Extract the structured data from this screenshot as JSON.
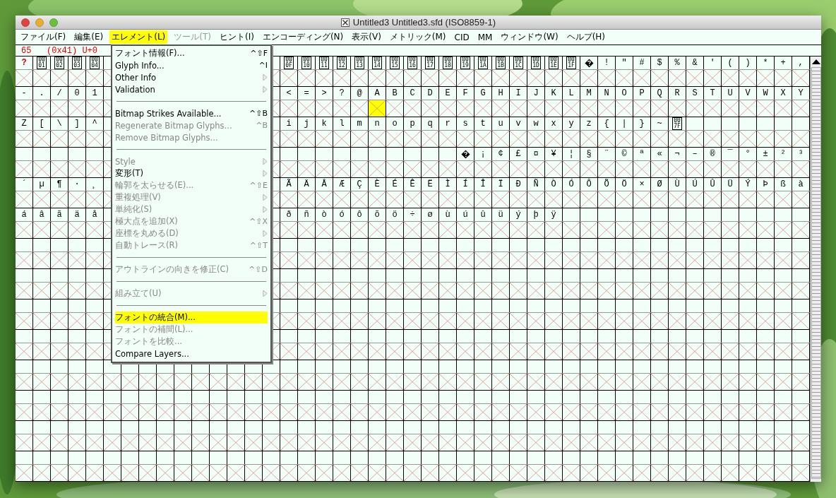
{
  "window": {
    "title": "Untitled3  Untitled3.sfd (ISO8859-1)"
  },
  "menubar": [
    {
      "label": "ファイル(F)",
      "selected": false,
      "disabled": false
    },
    {
      "label": "編集(E)",
      "selected": false,
      "disabled": false
    },
    {
      "label": "エレメント(L)",
      "selected": true,
      "disabled": false
    },
    {
      "label": "ツール(T)",
      "selected": false,
      "disabled": true
    },
    {
      "label": "ヒント(I)",
      "selected": false,
      "disabled": false
    },
    {
      "label": "エンコーディング(N)",
      "selected": false,
      "disabled": false
    },
    {
      "label": "表示(V)",
      "selected": false,
      "disabled": false
    },
    {
      "label": "メトリック(M)",
      "selected": false,
      "disabled": false
    },
    {
      "label": "CID",
      "selected": false,
      "disabled": false
    },
    {
      "label": "MM",
      "selected": false,
      "disabled": false
    },
    {
      "label": "ウィンドウ(W)",
      "selected": false,
      "disabled": false
    },
    {
      "label": "ヘルプ(H)",
      "selected": false,
      "disabled": false
    }
  ],
  "info_line": "65   (0x41) U+0",
  "menu": [
    {
      "kind": "item",
      "label": "フォント情報(F)...",
      "shortcut": "^⇧F",
      "disabled": false,
      "submenu": false,
      "selected": false
    },
    {
      "kind": "item",
      "label": "Glyph Info...",
      "shortcut": "^I",
      "disabled": false,
      "submenu": false,
      "selected": false
    },
    {
      "kind": "item",
      "label": "Other Info",
      "disabled": false,
      "submenu": true,
      "selected": false
    },
    {
      "kind": "item",
      "label": "Validation",
      "disabled": false,
      "submenu": true,
      "selected": false
    },
    {
      "kind": "separator"
    },
    {
      "kind": "item",
      "label": "Bitmap Strikes Available...",
      "shortcut": "^⇧B",
      "disabled": false,
      "submenu": false,
      "selected": false
    },
    {
      "kind": "item",
      "label": "Regenerate Bitmap Glyphs...",
      "shortcut": "^B",
      "disabled": true,
      "submenu": false,
      "selected": false
    },
    {
      "kind": "item",
      "label": "Remove Bitmap Glyphs...",
      "disabled": true,
      "submenu": false,
      "selected": false
    },
    {
      "kind": "separator"
    },
    {
      "kind": "item",
      "label": "Style",
      "disabled": true,
      "submenu": true,
      "selected": false
    },
    {
      "kind": "item",
      "label": "変形(T)",
      "disabled": false,
      "submenu": true,
      "selected": false
    },
    {
      "kind": "item",
      "label": "輪郭を太らせる(E)...",
      "shortcut": "^⇧E",
      "disabled": true,
      "submenu": false,
      "selected": false
    },
    {
      "kind": "item",
      "label": "重複処理(V)",
      "disabled": true,
      "submenu": true,
      "selected": false
    },
    {
      "kind": "item",
      "label": "単純化(S)",
      "disabled": true,
      "submenu": true,
      "selected": false
    },
    {
      "kind": "item",
      "label": "極大点を追加(X)",
      "shortcut": "^⇧X",
      "disabled": true,
      "submenu": false,
      "selected": false
    },
    {
      "kind": "item",
      "label": "座標を丸める(D)",
      "disabled": true,
      "submenu": true,
      "selected": false
    },
    {
      "kind": "item",
      "label": "自動トレース(R)",
      "shortcut": "^⇧T",
      "disabled": true,
      "submenu": false,
      "selected": false
    },
    {
      "kind": "separator"
    },
    {
      "kind": "item",
      "label": "アウトラインの向きを修正(C)",
      "shortcut": "^⇧D",
      "disabled": true,
      "submenu": false,
      "selected": false
    },
    {
      "kind": "separator"
    },
    {
      "kind": "item",
      "label": "組み立て(U)",
      "disabled": true,
      "submenu": true,
      "selected": false
    },
    {
      "kind": "separator"
    },
    {
      "kind": "item",
      "label": "フォントの統合(M)...",
      "disabled": false,
      "submenu": false,
      "selected": true
    },
    {
      "kind": "item",
      "label": "フォントの補間(L)...",
      "disabled": true,
      "submenu": false,
      "selected": false
    },
    {
      "kind": "item",
      "label": "フォントを比較...",
      "disabled": true,
      "submenu": false,
      "selected": false
    },
    {
      "kind": "item",
      "label": "Compare Layers...",
      "disabled": false,
      "submenu": false,
      "selected": false
    }
  ],
  "rows": [
    {
      "kind": "chars",
      "cells": [
        {
          "kind": "missing",
          "label": "?",
          "selected": false
        },
        {
          "kind": "code",
          "lines": [
            "00",
            "01"
          ],
          "selected": false
        },
        {
          "kind": "code",
          "lines": [
            "00",
            "02"
          ],
          "selected": false
        },
        {
          "kind": "code",
          "lines": [
            "00",
            "03"
          ],
          "selected": false
        },
        {
          "kind": "code",
          "lines": [
            "00",
            "04"
          ],
          "selected": false
        },
        null,
        null,
        null,
        null,
        null,
        null,
        null,
        null,
        null,
        null,
        {
          "kind": "code",
          "lines": [
            "00",
            "0F"
          ],
          "selected": false
        },
        {
          "kind": "code",
          "lines": [
            "00",
            "10"
          ],
          "selected": false
        },
        {
          "kind": "code",
          "lines": [
            "00",
            "11"
          ],
          "selected": false
        },
        {
          "kind": "code",
          "lines": [
            "00",
            "12"
          ],
          "selected": false
        },
        {
          "kind": "code",
          "lines": [
            "00",
            "13"
          ],
          "selected": false
        },
        {
          "kind": "code",
          "lines": [
            "00",
            "14"
          ],
          "selected": false
        },
        {
          "kind": "code",
          "lines": [
            "00",
            "15"
          ],
          "selected": false
        },
        {
          "kind": "code",
          "lines": [
            "00",
            "16"
          ],
          "selected": false
        },
        {
          "kind": "code",
          "lines": [
            "00",
            "17"
          ],
          "selected": false
        },
        {
          "kind": "code",
          "lines": [
            "00",
            "18"
          ],
          "selected": false
        },
        {
          "kind": "code",
          "lines": [
            "00",
            "19"
          ],
          "selected": false
        },
        {
          "kind": "code",
          "lines": [
            "00",
            "1A"
          ],
          "selected": false
        },
        {
          "kind": "code",
          "lines": [
            "00",
            "1B"
          ],
          "selected": false
        },
        {
          "kind": "code",
          "lines": [
            "00",
            "1C"
          ],
          "selected": false
        },
        {
          "kind": "code",
          "lines": [
            "00",
            "1D"
          ],
          "selected": false
        },
        {
          "kind": "code",
          "lines": [
            "00",
            "1E"
          ],
          "selected": false
        },
        {
          "kind": "code",
          "lines": [
            "00",
            "1F"
          ],
          "selected": false
        },
        {
          "kind": "replacement",
          "selected": false
        },
        {
          "kind": "char",
          "label": "!",
          "selected": false
        },
        {
          "kind": "char",
          "label": "\"",
          "selected": false
        },
        {
          "kind": "char",
          "label": "#",
          "selected": false
        },
        {
          "kind": "char",
          "label": "$",
          "selected": false
        },
        {
          "kind": "char",
          "label": "%",
          "selected": false
        },
        {
          "kind": "char",
          "label": "&",
          "selected": false
        },
        {
          "kind": "char",
          "label": "'",
          "selected": false
        },
        {
          "kind": "char",
          "label": "(",
          "selected": false
        },
        {
          "kind": "char",
          "label": ")",
          "selected": false
        },
        {
          "kind": "char",
          "label": "*",
          "selected": false
        },
        {
          "kind": "char",
          "label": "+",
          "selected": false
        },
        {
          "kind": "char",
          "label": ",",
          "selected": false
        }
      ]
    },
    {
      "kind": "chars",
      "cells": [
        {
          "kind": "char",
          "label": "-",
          "selected": false
        },
        {
          "kind": "char",
          "label": ".",
          "selected": false
        },
        {
          "kind": "char",
          "label": "/",
          "selected": false
        },
        {
          "kind": "char",
          "label": "0",
          "selected": false
        },
        {
          "kind": "char",
          "label": "1",
          "selected": false
        },
        null,
        null,
        null,
        null,
        null,
        null,
        null,
        null,
        null,
        null,
        {
          "kind": "char",
          "label": "<",
          "selected": false
        },
        {
          "kind": "char",
          "label": "=",
          "selected": false
        },
        {
          "kind": "char",
          "label": ">",
          "selected": false
        },
        {
          "kind": "char",
          "label": "?",
          "selected": false
        },
        {
          "kind": "char",
          "label": "@",
          "selected": false
        },
        {
          "kind": "char",
          "label": "A",
          "selected": true
        },
        {
          "kind": "char",
          "label": "B",
          "selected": false
        },
        {
          "kind": "char",
          "label": "C",
          "selected": false
        },
        {
          "kind": "char",
          "label": "D",
          "selected": false
        },
        {
          "kind": "char",
          "label": "E",
          "selected": false
        },
        {
          "kind": "char",
          "label": "F",
          "selected": false
        },
        {
          "kind": "char",
          "label": "G",
          "selected": false
        },
        {
          "kind": "char",
          "label": "H",
          "selected": false
        },
        {
          "kind": "char",
          "label": "I",
          "selected": false
        },
        {
          "kind": "char",
          "label": "J",
          "selected": false
        },
        {
          "kind": "char",
          "label": "K",
          "selected": false
        },
        {
          "kind": "char",
          "label": "L",
          "selected": false
        },
        {
          "kind": "char",
          "label": "M",
          "selected": false
        },
        {
          "kind": "char",
          "label": "N",
          "selected": false
        },
        {
          "kind": "char",
          "label": "O",
          "selected": false
        },
        {
          "kind": "char",
          "label": "P",
          "selected": false
        },
        {
          "kind": "char",
          "label": "Q",
          "selected": false
        },
        {
          "kind": "char",
          "label": "R",
          "selected": false
        },
        {
          "kind": "char",
          "label": "S",
          "selected": false
        },
        {
          "kind": "char",
          "label": "T",
          "selected": false
        },
        {
          "kind": "char",
          "label": "U",
          "selected": false
        },
        {
          "kind": "char",
          "label": "V",
          "selected": false
        },
        {
          "kind": "char",
          "label": "W",
          "selected": false
        },
        {
          "kind": "char",
          "label": "X",
          "selected": false
        },
        {
          "kind": "char",
          "label": "Y",
          "selected": false
        }
      ]
    },
    {
      "kind": "chars",
      "cells": [
        {
          "kind": "char",
          "label": "Z",
          "selected": false
        },
        {
          "kind": "char",
          "label": "[",
          "selected": false
        },
        {
          "kind": "char",
          "label": "\\",
          "selected": false
        },
        {
          "kind": "char",
          "label": "]",
          "selected": false
        },
        {
          "kind": "char",
          "label": "^",
          "selected": false
        },
        null,
        null,
        null,
        null,
        null,
        null,
        null,
        null,
        null,
        null,
        {
          "kind": "char",
          "label": "i",
          "selected": false
        },
        {
          "kind": "char",
          "label": "j",
          "selected": false
        },
        {
          "kind": "char",
          "label": "k",
          "selected": false
        },
        {
          "kind": "char",
          "label": "l",
          "selected": false
        },
        {
          "kind": "char",
          "label": "m",
          "selected": false
        },
        {
          "kind": "char",
          "label": "n",
          "selected": false
        },
        {
          "kind": "char",
          "label": "o",
          "selected": false
        },
        {
          "kind": "char",
          "label": "p",
          "selected": false
        },
        {
          "kind": "char",
          "label": "q",
          "selected": false
        },
        {
          "kind": "char",
          "label": "r",
          "selected": false
        },
        {
          "kind": "char",
          "label": "s",
          "selected": false
        },
        {
          "kind": "char",
          "label": "t",
          "selected": false
        },
        {
          "kind": "char",
          "label": "u",
          "selected": false
        },
        {
          "kind": "char",
          "label": "v",
          "selected": false
        },
        {
          "kind": "char",
          "label": "w",
          "selected": false
        },
        {
          "kind": "char",
          "label": "x",
          "selected": false
        },
        {
          "kind": "char",
          "label": "y",
          "selected": false
        },
        {
          "kind": "char",
          "label": "z",
          "selected": false
        },
        {
          "kind": "char",
          "label": "{",
          "selected": false
        },
        {
          "kind": "char",
          "label": "|",
          "selected": false
        },
        {
          "kind": "char",
          "label": "}",
          "selected": false
        },
        {
          "kind": "char",
          "label": "~",
          "selected": false
        },
        {
          "kind": "code",
          "lines": [
            "00",
            "7F"
          ],
          "selected": false
        },
        {
          "kind": "blank"
        },
        {
          "kind": "blank"
        },
        {
          "kind": "blank"
        },
        {
          "kind": "blank"
        },
        {
          "kind": "blank"
        },
        {
          "kind": "blank"
        },
        {
          "kind": "blank"
        }
      ]
    },
    {
      "kind": "chars",
      "cells": [
        {
          "kind": "blank"
        },
        {
          "kind": "blank"
        },
        {
          "kind": "blank"
        },
        {
          "kind": "blank"
        },
        {
          "kind": "blank"
        },
        null,
        null,
        null,
        null,
        null,
        null,
        null,
        null,
        null,
        null,
        {
          "kind": "blank"
        },
        {
          "kind": "blank"
        },
        {
          "kind": "blank"
        },
        {
          "kind": "blank"
        },
        {
          "kind": "blank"
        },
        {
          "kind": "blank"
        },
        {
          "kind": "blank"
        },
        {
          "kind": "blank"
        },
        {
          "kind": "blank"
        },
        {
          "kind": "blank"
        },
        {
          "kind": "replacement",
          "selected": false
        },
        {
          "kind": "char",
          "label": "¡",
          "selected": false
        },
        {
          "kind": "char",
          "label": "¢",
          "selected": false
        },
        {
          "kind": "char",
          "label": "£",
          "selected": false
        },
        {
          "kind": "char",
          "label": "¤",
          "selected": false
        },
        {
          "kind": "char",
          "label": "¥",
          "selected": false
        },
        {
          "kind": "char",
          "label": "¦",
          "selected": false
        },
        {
          "kind": "char",
          "label": "§",
          "selected": false
        },
        {
          "kind": "char",
          "label": "¨",
          "selected": false
        },
        {
          "kind": "char",
          "label": "©",
          "selected": false
        },
        {
          "kind": "char",
          "label": "ª",
          "selected": false
        },
        {
          "kind": "char",
          "label": "«",
          "selected": false
        },
        {
          "kind": "char",
          "label": "¬",
          "selected": false
        },
        {
          "kind": "char",
          "label": "–",
          "selected": false
        },
        {
          "kind": "char",
          "label": "®",
          "selected": false
        },
        {
          "kind": "char",
          "label": "¯",
          "selected": false
        },
        {
          "kind": "char",
          "label": "°",
          "selected": false
        },
        {
          "kind": "char",
          "label": "±",
          "selected": false
        },
        {
          "kind": "char",
          "label": "²",
          "selected": false
        },
        {
          "kind": "char",
          "label": "³",
          "selected": false
        }
      ]
    },
    {
      "kind": "chars",
      "cells": [
        {
          "kind": "char",
          "label": "´",
          "selected": false
        },
        {
          "kind": "char",
          "label": "µ",
          "selected": false
        },
        {
          "kind": "char",
          "label": "¶",
          "selected": false
        },
        {
          "kind": "char",
          "label": "·",
          "selected": false
        },
        {
          "kind": "char",
          "label": "¸",
          "selected": false
        },
        null,
        null,
        null,
        null,
        null,
        null,
        null,
        null,
        null,
        null,
        {
          "kind": "char",
          "label": "Ã",
          "selected": false
        },
        {
          "kind": "char",
          "label": "Ä",
          "selected": false
        },
        {
          "kind": "char",
          "label": "Å",
          "selected": false
        },
        {
          "kind": "char",
          "label": "Æ",
          "selected": false
        },
        {
          "kind": "char",
          "label": "Ç",
          "selected": false
        },
        {
          "kind": "char",
          "label": "È",
          "selected": false
        },
        {
          "kind": "char",
          "label": "É",
          "selected": false
        },
        {
          "kind": "char",
          "label": "Ê",
          "selected": false
        },
        {
          "kind": "char",
          "label": "Ë",
          "selected": false
        },
        {
          "kind": "char",
          "label": "Ì",
          "selected": false
        },
        {
          "kind": "char",
          "label": "Í",
          "selected": false
        },
        {
          "kind": "char",
          "label": "Î",
          "selected": false
        },
        {
          "kind": "char",
          "label": "Ï",
          "selected": false
        },
        {
          "kind": "char",
          "label": "Ð",
          "selected": false
        },
        {
          "kind": "char",
          "label": "Ñ",
          "selected": false
        },
        {
          "kind": "char",
          "label": "Ò",
          "selected": false
        },
        {
          "kind": "char",
          "label": "Ó",
          "selected": false
        },
        {
          "kind": "char",
          "label": "Ô",
          "selected": false
        },
        {
          "kind": "char",
          "label": "Õ",
          "selected": false
        },
        {
          "kind": "char",
          "label": "Ö",
          "selected": false
        },
        {
          "kind": "char",
          "label": "×",
          "selected": false
        },
        {
          "kind": "char",
          "label": "Ø",
          "selected": false
        },
        {
          "kind": "char",
          "label": "Ù",
          "selected": false
        },
        {
          "kind": "char",
          "label": "Ú",
          "selected": false
        },
        {
          "kind": "char",
          "label": "Û",
          "selected": false
        },
        {
          "kind": "char",
          "label": "Ü",
          "selected": false
        },
        {
          "kind": "char",
          "label": "Ý",
          "selected": false
        },
        {
          "kind": "char",
          "label": "Þ",
          "selected": false
        },
        {
          "kind": "char",
          "label": "ß",
          "selected": false
        },
        {
          "kind": "char",
          "label": "à",
          "selected": false
        }
      ]
    },
    {
      "kind": "chars",
      "cells": [
        {
          "kind": "char",
          "label": "á",
          "selected": false
        },
        {
          "kind": "char",
          "label": "â",
          "selected": false
        },
        {
          "kind": "char",
          "label": "ã",
          "selected": false
        },
        {
          "kind": "char",
          "label": "ä",
          "selected": false
        },
        {
          "kind": "char",
          "label": "å",
          "selected": false
        },
        null,
        null,
        null,
        null,
        null,
        null,
        null,
        null,
        null,
        null,
        {
          "kind": "char",
          "label": "ð",
          "selected": false
        },
        {
          "kind": "char",
          "label": "ñ",
          "selected": false
        },
        {
          "kind": "char",
          "label": "ò",
          "selected": false
        },
        {
          "kind": "char",
          "label": "ó",
          "selected": false
        },
        {
          "kind": "char",
          "label": "ô",
          "selected": false
        },
        {
          "kind": "char",
          "label": "õ",
          "selected": false
        },
        {
          "kind": "char",
          "label": "ö",
          "selected": false
        },
        {
          "kind": "char",
          "label": "÷",
          "selected": false
        },
        {
          "kind": "char",
          "label": "ø",
          "selected": false
        },
        {
          "kind": "char",
          "label": "ù",
          "selected": false
        },
        {
          "kind": "char",
          "label": "ú",
          "selected": false
        },
        {
          "kind": "char",
          "label": "û",
          "selected": false
        },
        {
          "kind": "char",
          "label": "ü",
          "selected": false
        },
        {
          "kind": "char",
          "label": "ý",
          "selected": false
        },
        {
          "kind": "char",
          "label": "þ",
          "selected": false
        },
        {
          "kind": "char",
          "label": "ÿ",
          "selected": false
        },
        {
          "kind": "blank"
        },
        {
          "kind": "blank"
        },
        {
          "kind": "blank"
        },
        {
          "kind": "blank"
        },
        {
          "kind": "blank"
        },
        {
          "kind": "blank"
        },
        {
          "kind": "blank"
        },
        {
          "kind": "blank"
        },
        {
          "kind": "blank"
        },
        {
          "kind": "blank"
        },
        {
          "kind": "blank"
        },
        {
          "kind": "blank"
        },
        {
          "kind": "blank"
        },
        {
          "kind": "blank"
        }
      ]
    },
    {
      "kind": "blank"
    },
    {
      "kind": "blank"
    },
    {
      "kind": "blank"
    },
    {
      "kind": "blank"
    },
    {
      "kind": "blank"
    },
    {
      "kind": "blank"
    },
    {
      "kind": "blank"
    },
    {
      "kind": "blank"
    }
  ]
}
